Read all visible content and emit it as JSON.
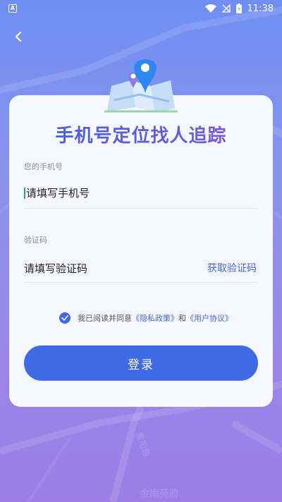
{
  "status_bar": {
    "time": "11:38",
    "notification_icon": "A",
    "icons": [
      "wifi-icon",
      "signal-off-icon",
      "battery-icon"
    ]
  },
  "header": {
    "back_icon": "chevron-left-icon"
  },
  "app": {
    "title": "手机号定位找人追踪"
  },
  "form": {
    "phone_label": "您的手机号",
    "phone_placeholder": "请填写手机号",
    "code_label": "验证码",
    "code_placeholder": "请填写验证码",
    "get_code_label": "获取验证码"
  },
  "agreement": {
    "prefix": "我已阅读并同意",
    "privacy_link": "《隐私政策》",
    "and": "和",
    "user_link": "《用户协议》",
    "checked": true
  },
  "login_button": "登录",
  "map_labels": [
    "金南苑府",
    "紫阳路"
  ],
  "colors": {
    "accent": "#3f6ae6",
    "card_bg": "#f6f7ff",
    "pin_blue": "#2e86f0"
  }
}
